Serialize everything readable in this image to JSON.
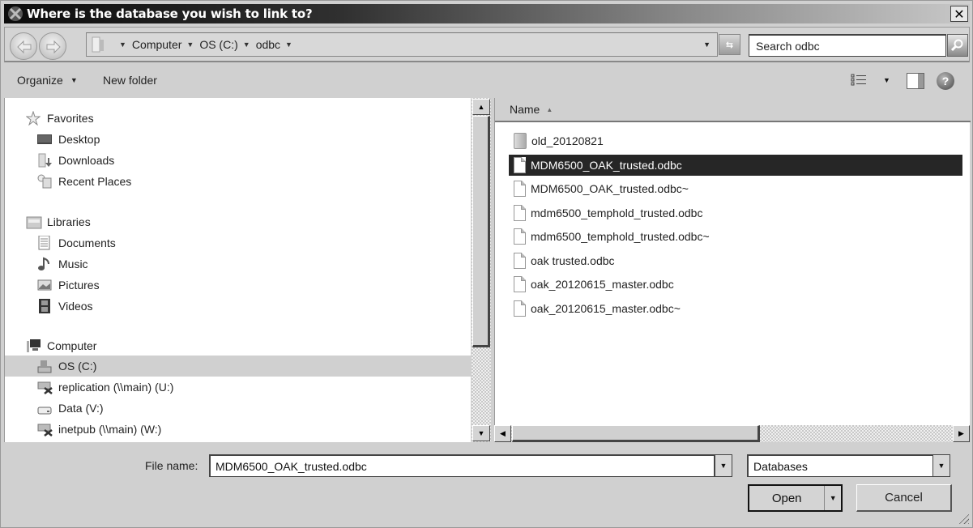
{
  "window": {
    "title": "Where is the database you wish to link to?",
    "close_label": "✕"
  },
  "nav": {
    "back_label": "Back",
    "forward_label": "Forward",
    "breadcrumb": [
      "Computer",
      "OS (C:)",
      "odbc"
    ],
    "search_placeholder": "Search odbc"
  },
  "toolbar": {
    "organize_label": "Organize",
    "new_folder_label": "New folder",
    "help_label": "?"
  },
  "sidebar": {
    "groups": [
      {
        "label": "Favorites",
        "icon": "star-icon",
        "items": [
          {
            "label": "Desktop",
            "icon": "desktop-icon"
          },
          {
            "label": "Downloads",
            "icon": "downloads-icon"
          },
          {
            "label": "Recent Places",
            "icon": "recent-places-icon"
          }
        ]
      },
      {
        "label": "Libraries",
        "icon": "libraries-icon",
        "items": [
          {
            "label": "Documents",
            "icon": "documents-icon"
          },
          {
            "label": "Music",
            "icon": "music-icon"
          },
          {
            "label": "Pictures",
            "icon": "pictures-icon"
          },
          {
            "label": "Videos",
            "icon": "videos-icon"
          }
        ]
      },
      {
        "label": "Computer",
        "icon": "computer-icon",
        "items": [
          {
            "label": "OS (C:)",
            "icon": "drive-icon",
            "selected": true
          },
          {
            "label": "replication (\\\\main) (U:)",
            "icon": "network-drive-icon"
          },
          {
            "label": "Data (V:)",
            "icon": "drive-icon"
          },
          {
            "label": "inetpub (\\\\main) (W:)",
            "icon": "network-drive-icon"
          }
        ]
      }
    ]
  },
  "filelist": {
    "column_name": "Name",
    "files": [
      {
        "name": "old_20120821",
        "type": "folder"
      },
      {
        "name": "MDM6500_OAK_trusted.odbc",
        "type": "file",
        "selected": true
      },
      {
        "name": "MDM6500_OAK_trusted.odbc~",
        "type": "file"
      },
      {
        "name": "mdm6500_temphold_trusted.odbc",
        "type": "file"
      },
      {
        "name": "mdm6500_temphold_trusted.odbc~",
        "type": "file"
      },
      {
        "name": "oak trusted.odbc",
        "type": "file"
      },
      {
        "name": "oak_20120615_master.odbc",
        "type": "file"
      },
      {
        "name": "oak_20120615_master.odbc~",
        "type": "file"
      }
    ]
  },
  "footer": {
    "file_name_label": "File name:",
    "file_name_value": "MDM6500_OAK_trusted.odbc",
    "file_type_value": "Databases",
    "open_label": "Open",
    "cancel_label": "Cancel"
  }
}
